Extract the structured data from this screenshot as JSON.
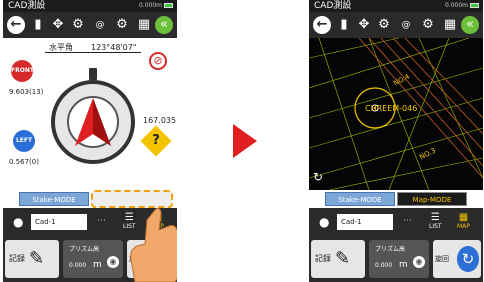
{
  "status": {
    "title": "CAD測設",
    "distance": "0.000m"
  },
  "toolbar_icons": [
    "back-arrow-icon",
    "prism-icon",
    "move-icon",
    "document-gear-icon",
    "at-icon",
    "settings-gear-icon",
    "map-settings-icon",
    "green-back-icon"
  ],
  "left_screen": {
    "angle_label": "水平角",
    "angle_value": "123°48'07\"",
    "front_badge": "FRONT",
    "front_value": "9.603(13)",
    "left_badge": "LEFT",
    "left_value": "0.567(0)",
    "right_value": "167.035",
    "question": "?",
    "mode_label": "Stake-MODE"
  },
  "right_screen": {
    "point_label": "CHREEM-046",
    "line_label_1": "NO.4",
    "line_label_2": "NO.3",
    "mode_stake": "Stake-MODE",
    "mode_map": "Map-MODE"
  },
  "input": {
    "value": "Cad-1",
    "list_label": "LIST",
    "map_label": "MAP"
  },
  "bottom": {
    "record_label": "記録",
    "prism_label": "プリズム高",
    "prism_value": "0.000",
    "prism_unit": "m",
    "rotate_label": "旋回"
  },
  "colors": {
    "accent_red": "#d62a2a",
    "accent_blue": "#2a6ed6",
    "map_yellow": "#f5c400",
    "highlight_orange": "#f0a000"
  }
}
